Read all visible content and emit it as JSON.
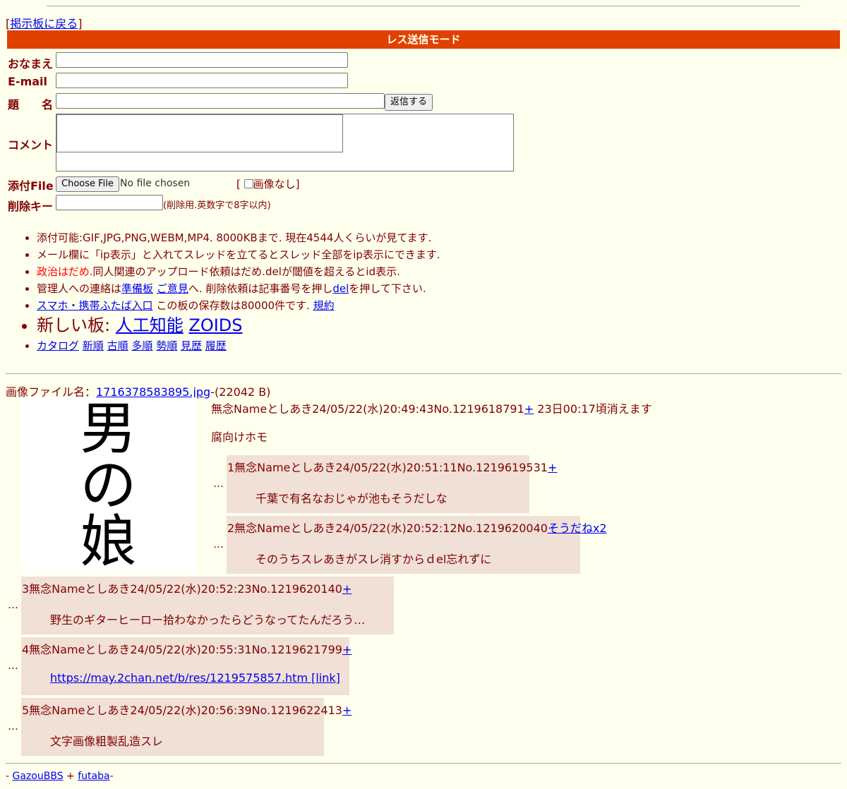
{
  "back_link": "掲示板に戻る",
  "mode_title": "レス送信モード",
  "form": {
    "name_label": "おなまえ",
    "email_label": "E-mail",
    "subject_label": "題　　名",
    "submit_label": "返信する",
    "comment_label": "コメント",
    "file_label": "添付File",
    "choose_file": "Choose File",
    "no_file": "No file chosen",
    "no_image_label": "画像なし",
    "delkey_label": "削除キー",
    "delkey_note": "(削除用.英数字で8字以内)"
  },
  "rules": {
    "r1": "添付可能:GIF,JPG,PNG,WEBM,MP4. 8000KBまで. 現在4544人くらいが見てます.",
    "r2": "メール欄に「ip表示」と入れてスレッドを立てるとスレッド全部をip表示にできます.",
    "r3_red": "政治はだめ.",
    "r3_rest": "同人関連のアップロード依頼はだめ.delが閾値を超えるとid表示.",
    "r4_a": "管理人への連絡は",
    "r4_link1": "準備板",
    "r4_link2": "ご意見",
    "r4_b": "へ. 削除依頼は記事番号を押し",
    "r4_link3": "del",
    "r4_c": "を押して下さい.",
    "r5_link": "スマホ・携帯ふたば入口",
    "r5_text": "この板の保存数は80000件です.",
    "r5_link2": "規約",
    "r6_text": "新しい板:",
    "r6_link1": "人工知能",
    "r6_link2": "ZOIDS",
    "r7": [
      "カタログ",
      "新順",
      "古順",
      "多順",
      "勢順",
      "見歴",
      "履歴"
    ]
  },
  "thread": {
    "file_prefix": "画像ファイル名：",
    "file_name": "1716378583895.jpg",
    "file_size": "-(22042 B)",
    "thumb_chars": [
      "男",
      "の",
      "娘"
    ],
    "op_head": "無念Nameとしあき24/05/22(水)20:49:43No.1219618791",
    "op_plus": "+",
    "op_expire": "23日00:17頃消えます",
    "op_body": "腐向けホモ"
  },
  "replies": [
    {
      "head": "1無念Nameとしあき24/05/22(水)20:51:11No.1219619531",
      "tail": "+",
      "body": "千葉で有名なおじゃが池もそうだしな"
    },
    {
      "head": "2無念Nameとしあき24/05/22(水)20:52:12No.1219620040",
      "tail": "そうだねx2",
      "body": "そのうちスレあきがスレ消すからｄel忘れずに"
    },
    {
      "head": "3無念Nameとしあき24/05/22(水)20:52:23No.1219620140",
      "tail": "+",
      "body": "野生のギターヒーロー拾わなかったらどうなってたんだろう…"
    },
    {
      "head": "4無念Nameとしあき24/05/22(水)20:55:31No.1219621799",
      "tail": "+",
      "body": "https://may.2chan.net/b/res/1219575857.htm [link]"
    },
    {
      "head": "5無念Nameとしあき24/05/22(水)20:56:39No.1219622413",
      "tail": "+",
      "body": "文字画像粗製乱造スレ"
    }
  ],
  "ellipsis": "…",
  "footer": {
    "dash1": "- ",
    "link1": "GazouBBS",
    "plus": " + ",
    "link2": "futaba",
    "dash2": "-"
  },
  "colors": {
    "background": "#ffffee",
    "text": "#800000",
    "mode_bar": "#e04000",
    "reply_bg": "#f0e0d6",
    "link": "#0000ee"
  }
}
